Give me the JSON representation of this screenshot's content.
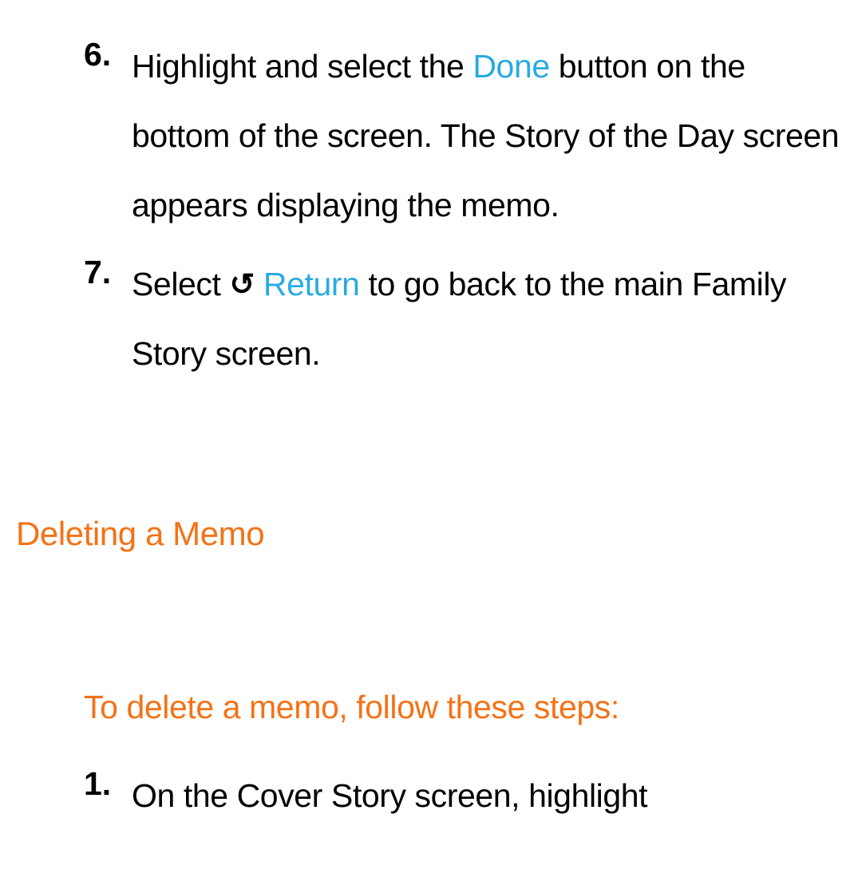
{
  "steps_a": [
    {
      "num": "6.",
      "pre": "Highlight and select the ",
      "hl": "Done",
      "post": " button on the bottom of the screen. The Story of the Day screen appears displaying the memo."
    },
    {
      "num": "7.",
      "pre": "Select ",
      "icon": "↺",
      "hl": "Return",
      "post": " to go back to the main Family Story screen."
    }
  ],
  "heading": "Deleting a Memo",
  "subheading": "To delete a memo, follow these steps:",
  "steps_b": [
    {
      "num": "1.",
      "text": "On the Cover Story screen, highlight"
    }
  ]
}
